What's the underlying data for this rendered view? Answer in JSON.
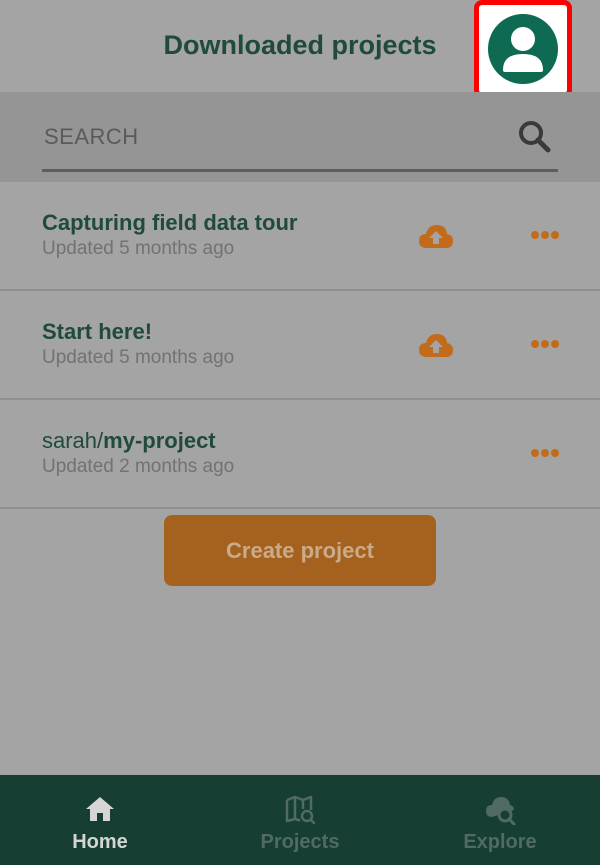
{
  "header": {
    "title": "Downloaded projects"
  },
  "search": {
    "placeholder": "SEARCH",
    "value": ""
  },
  "projects": [
    {
      "namespace": "",
      "name": "Capturing field data tour",
      "updated": "Updated 5 months ago",
      "sync_icon": "cloud-upload-icon",
      "menu_icon": "more-icon"
    },
    {
      "namespace": "",
      "name": "Start here!",
      "updated": "Updated 5 months ago",
      "sync_icon": "cloud-upload-icon",
      "menu_icon": "more-icon"
    },
    {
      "namespace": "sarah/",
      "name": "my-project",
      "updated": "Updated 2 months ago",
      "menu_icon": "more-icon"
    }
  ],
  "create_button": {
    "label": "Create project"
  },
  "bottom_nav": {
    "items": [
      {
        "label": "Home",
        "icon": "home-icon",
        "active": true
      },
      {
        "label": "Projects",
        "icon": "map-search-icon",
        "active": false
      },
      {
        "label": "Explore",
        "icon": "cloud-search-icon",
        "active": false
      }
    ]
  },
  "colors": {
    "accent": "#0e6a52",
    "orange": "#c26c1b",
    "title_green": "#1f4a3c",
    "nav_bg": "#173e33",
    "highlight": "#ff0000"
  }
}
